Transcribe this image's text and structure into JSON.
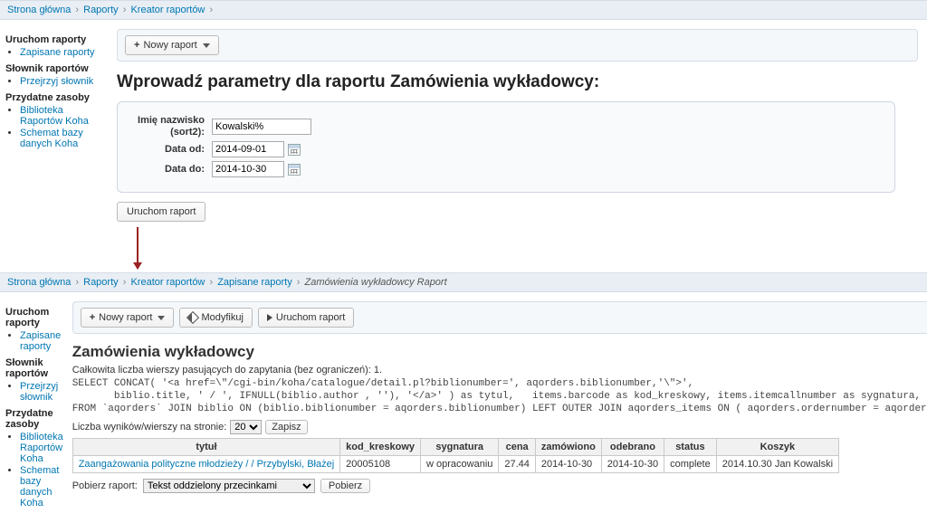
{
  "breadcrumb1": {
    "home": "Strona główna",
    "reports": "Raporty",
    "wizard": "Kreator raportów"
  },
  "breadcrumb2": {
    "home": "Strona główna",
    "reports": "Raporty",
    "wizard": "Kreator raportów",
    "saved": "Zapisane raporty",
    "current": "Zamówienia wykładowcy Raport"
  },
  "sidebar": {
    "h1": "Uruchom raporty",
    "i1": "Zapisane raporty",
    "h2": "Słownik raportów",
    "i2": "Przejrzyj słownik",
    "h3": "Przydatne zasoby",
    "i3": "Biblioteka Raportów Koha",
    "i4": "Schemat bazy danych Koha"
  },
  "toolbar": {
    "new_report": "Nowy raport",
    "modify": "Modyfikuj",
    "run_report": "Uruchom raport"
  },
  "top": {
    "title": "Wprowadź parametry dla raportu Zamówienia wykładowcy:",
    "label_name": "Imię nazwisko (sort2):",
    "val_name": "Kowalski%",
    "label_from": "Data od:",
    "val_from": "2014-09-01",
    "label_to": "Data do:",
    "val_to": "2014-10-30",
    "run": "Uruchom raport"
  },
  "bottom": {
    "title": "Zamówienia wykładowcy",
    "summary": "Całkowita liczba wierszy pasujących do zapytania (bez ograniczeń): 1.",
    "sql": "SELECT CONCAT( '<a href=\\\"/cgi-bin/koha/catalogue/detail.pl?biblionumber=', aqorders.biblionumber,'\\\">',\n       biblio.title, ' / ', IFNULL(biblio.author , ''), '</a>' ) as tytul,   items.barcode as kod_kreskowy, items.itemcallnumber as sygnatura, items.price as\nFROM `aqorders` JOIN biblio ON (biblio.biblionumber = aqorders.biblionumber) LEFT OUTER JOIN aqorders_items ON ( aqorders.ordernumber = aqorders_items.ordern",
    "rows_label": "Liczba wyników/wierszy na stronie:",
    "rows_value": "20",
    "save": "Zapisz",
    "headers": {
      "c1": "tytuł",
      "c2": "kod_kreskowy",
      "c3": "sygnatura",
      "c4": "cena",
      "c5": "zamówiono",
      "c6": "odebrano",
      "c7": "status",
      "c8": "Koszyk"
    },
    "row": {
      "c1": "Zaangażowania polityczne młodzieży / / Przybylski, Błażej",
      "c2": "20005108",
      "c3": "w opracowaniu",
      "c4": "27.44",
      "c5": "2014-10-30",
      "c6": "2014-10-30",
      "c7": "complete",
      "c8": "2014.10.30 Jan Kowalski"
    },
    "download_label": "Pobierz raport:",
    "download_option": "Tekst oddzielony przecinkami",
    "download_btn": "Pobierz"
  }
}
